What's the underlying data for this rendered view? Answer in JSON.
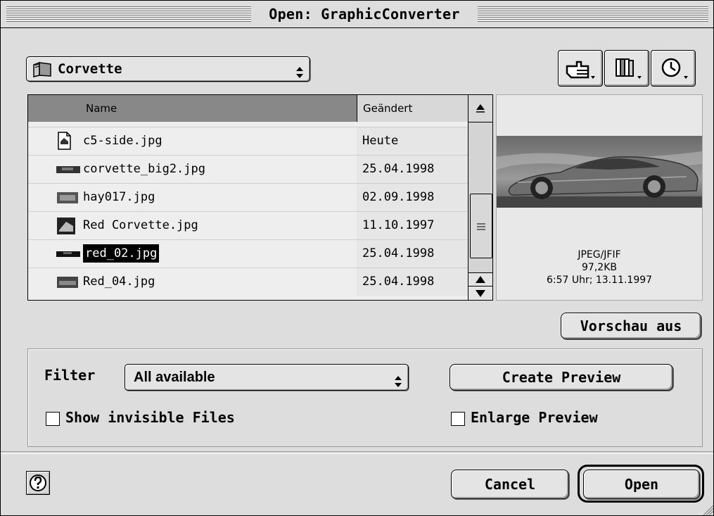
{
  "window": {
    "title": "Open: GraphicConverter"
  },
  "folder_popup": {
    "label": "Corvette"
  },
  "toolbar": {
    "icons": [
      "hand-pointer-icon",
      "books-icon",
      "clock-icon"
    ]
  },
  "file_list": {
    "columns": {
      "name": "Name",
      "modified": "Geändert"
    },
    "rows": [
      {
        "name": "c5-side.jpg",
        "date": "Heute",
        "selected": false
      },
      {
        "name": "corvette_big2.jpg",
        "date": "25.04.1998",
        "selected": false
      },
      {
        "name": "hay017.jpg",
        "date": "02.09.1998",
        "selected": false
      },
      {
        "name": "Red Corvette.jpg",
        "date": "11.10.1997",
        "selected": false
      },
      {
        "name": "red_02.jpg",
        "date": "25.04.1998",
        "selected": true
      },
      {
        "name": "Red_04.jpg",
        "date": "25.04.1998",
        "selected": false
      }
    ]
  },
  "preview": {
    "format": "JPEG/JFIF",
    "size": "97,2KB",
    "datetime": "6:57 Uhr; 13.11.1997",
    "toggle_label": "Vorschau aus"
  },
  "options": {
    "filter_label": "Filter",
    "filter_value": "All available",
    "create_preview_label": "Create Preview",
    "show_invisible_label": "Show invisible Files",
    "show_invisible_checked": false,
    "enlarge_preview_label": "Enlarge Preview",
    "enlarge_preview_checked": false
  },
  "footer": {
    "cancel_label": "Cancel",
    "open_label": "Open"
  }
}
